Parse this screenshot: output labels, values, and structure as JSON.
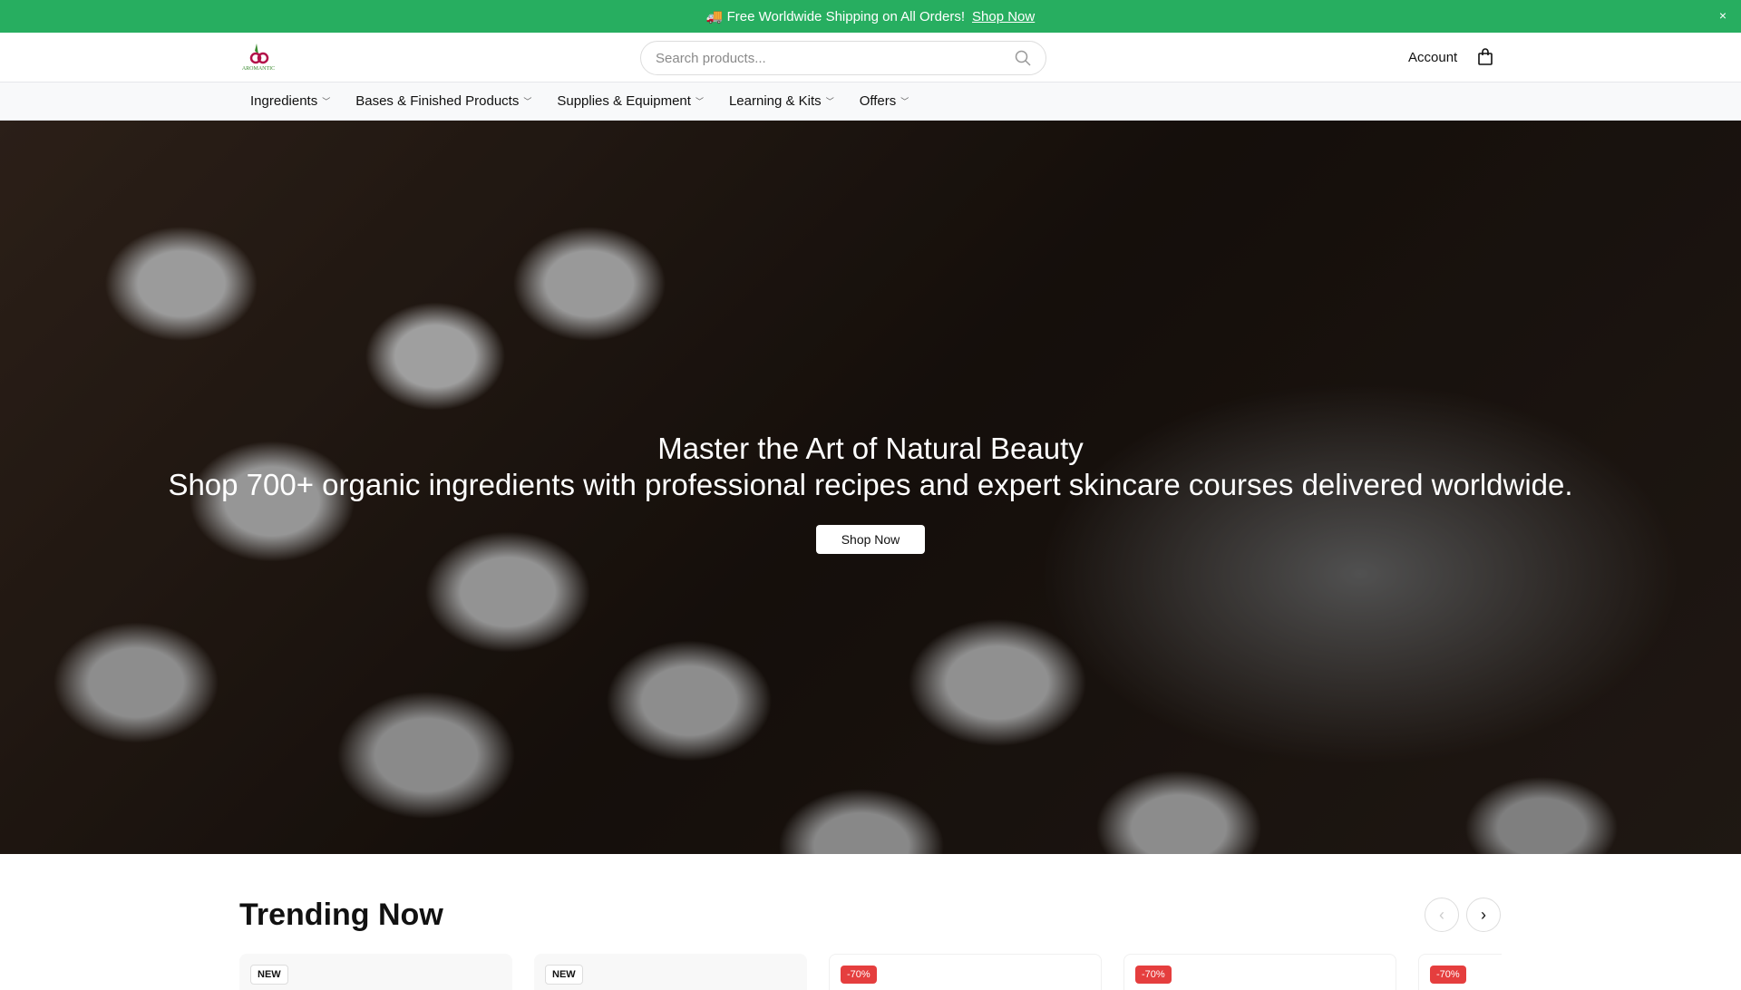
{
  "promo": {
    "icon": "🚚",
    "text": "Free Worldwide Shipping on All Orders!",
    "link": "Shop Now",
    "close": "×"
  },
  "header": {
    "logo_text": "AROMANTIC",
    "search_placeholder": "Search products...",
    "account": "Account"
  },
  "nav": [
    {
      "label": "Ingredients"
    },
    {
      "label": "Bases & Finished Products"
    },
    {
      "label": "Supplies & Equipment"
    },
    {
      "label": "Learning & Kits"
    },
    {
      "label": "Offers"
    }
  ],
  "hero": {
    "title": "Master the Art of Natural Beauty",
    "subtitle": "Shop 700+ organic ingredients with professional recipes and expert skincare courses delivered worldwide.",
    "cta": "Shop Now"
  },
  "trending": {
    "title": "Trending Now",
    "prev": "‹",
    "next": "›",
    "cards": [
      {
        "badge": "NEW"
      },
      {
        "badge": "NEW"
      },
      {
        "badge": "-70%"
      },
      {
        "badge": "-70%"
      },
      {
        "badge": "-70%"
      }
    ]
  },
  "colors": {
    "promo": "#27ae60",
    "sale": "#e53e3e"
  }
}
